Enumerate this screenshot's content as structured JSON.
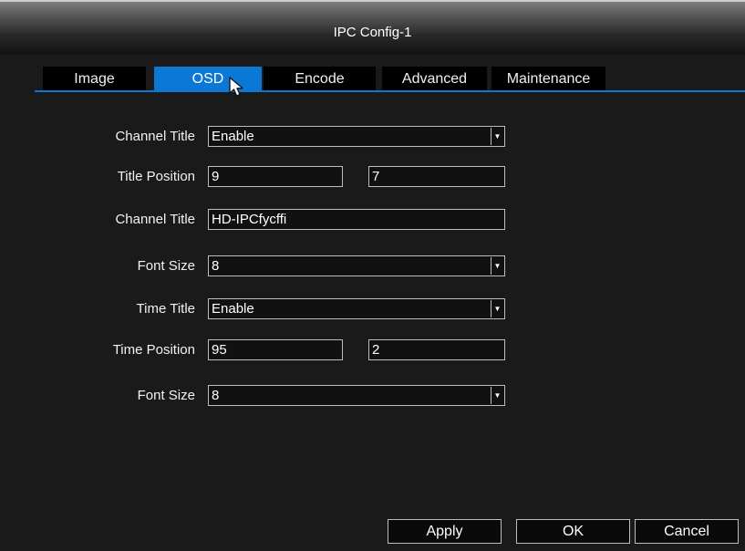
{
  "window": {
    "title": "IPC Config-1"
  },
  "tabs": [
    {
      "label": "Image",
      "active": false
    },
    {
      "label": "OSD",
      "active": true
    },
    {
      "label": "Encode",
      "active": false
    },
    {
      "label": "Advanced",
      "active": false
    },
    {
      "label": "Maintenance",
      "active": false
    }
  ],
  "form": {
    "channel_title_toggle": {
      "label": "Channel Title",
      "value": "Enable"
    },
    "title_position": {
      "label": "Title Position",
      "x": "9",
      "y": "7"
    },
    "channel_title_text": {
      "label": "Channel Title",
      "value": "HD-IPCfycffi"
    },
    "title_font_size": {
      "label": "Font Size",
      "value": "8"
    },
    "time_title_toggle": {
      "label": "Time Title",
      "value": "Enable"
    },
    "time_position": {
      "label": "Time Position",
      "x": "95",
      "y": "2"
    },
    "time_font_size": {
      "label": "Font Size",
      "value": "8"
    }
  },
  "buttons": {
    "apply": "Apply",
    "ok": "OK",
    "cancel": "Cancel"
  },
  "colors": {
    "accent": "#0b78d6",
    "background": "#1a1a1a",
    "border": "#bdbdbd"
  },
  "icons": {
    "dropdown": "dropdown-arrow-icon",
    "cursor": "mouse-pointer-icon"
  }
}
